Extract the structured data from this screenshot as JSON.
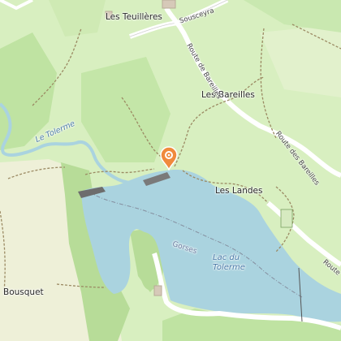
{
  "map": {
    "labels": {
      "les_teuilleres": "Les Teuillères",
      "les_bareilles": "Les Bareilles",
      "les_landes": "Les Landes",
      "bousquet": "Bousquet",
      "lac_du": "Lac du",
      "tolerme": "Tolerme",
      "le_tolerme": "Le Tolerme",
      "gorses": "Gorses",
      "route_bareilles_north": "Route de Bareilles",
      "route_bareilles_east": "Route des Bareilles",
      "sousceyrac_fragment": "Sousceyra",
      "route_fragment": "Route"
    },
    "marker": {
      "icon": "location-pin-icon",
      "color": "#f08a3c"
    },
    "colors": {
      "meadow": "#d8efc0",
      "forest": "#bfe3a2",
      "water": "#aad3df",
      "grassland": "#eef0d8",
      "road": "#ffffff",
      "path": "#9b8a63"
    }
  }
}
